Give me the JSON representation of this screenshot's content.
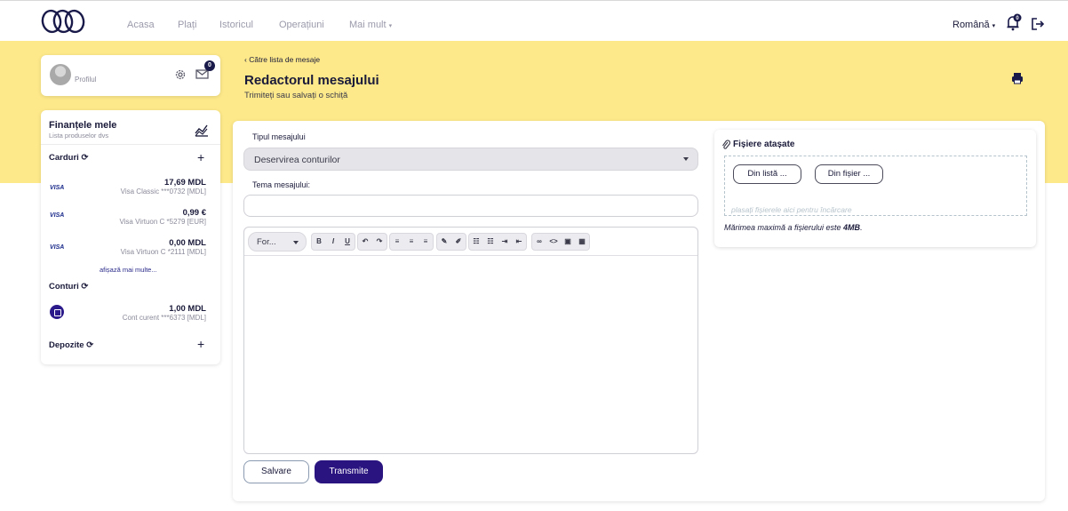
{
  "nav": {
    "items": [
      "Acasa",
      "Plați",
      "Istoricul",
      "Operațiuni",
      "Mai mult"
    ],
    "language": "Română",
    "notification_count": "0"
  },
  "sidebar": {
    "profile_label": "Profilul",
    "mail_count": "0",
    "finances_title": "Finanțele mele",
    "finances_subtitle": "Lista produselor dvs",
    "cards_title": "Carduri",
    "cards": [
      {
        "brand": "VISA",
        "amount": "17,69 MDL",
        "name": "Visa Classic ***0732 [MDL]"
      },
      {
        "brand": "VISA",
        "amount": "0,99 €",
        "name": "Visa Virtuon C *5279 [EUR]"
      },
      {
        "brand": "VISA",
        "amount": "0,00 MDL",
        "name": "Visa Virtuon C *2111 [MDL]"
      }
    ],
    "show_more": "afișază mai multe...",
    "accounts_title": "Conturi",
    "accounts": [
      {
        "amount": "1,00 MDL",
        "name": "Cont curent ***6373 [MDL]"
      }
    ],
    "deposits_title": "Depozite"
  },
  "header": {
    "back_link": "Către lista de mesaje",
    "title": "Redactorul mesajului",
    "subtitle": "Trimiteți sau salvați o schiță"
  },
  "form": {
    "type_label": "Tipul mesajului",
    "type_value": "Deservirea conturilor",
    "subject_label": "Tema mesajului:",
    "subject_value": "",
    "format_select": "For...",
    "toolbar_buttons": [
      "B",
      "I",
      "U",
      "↶",
      "↷",
      "≡",
      "≡",
      "≡",
      "✎",
      "✐",
      "☷",
      "☷",
      "⇥",
      "⇤",
      "∞",
      "<>",
      "▣",
      "▦"
    ],
    "save_label": "Salvare",
    "send_label": "Transmite"
  },
  "attachments": {
    "title": "Fișiere atașate",
    "from_list": "Din listă ...",
    "from_file": "Din fișier ...",
    "drop_hint": "plasați fișierele aici pentru încărcare",
    "max_size_prefix": "Mărimea maximă a fișierului este ",
    "max_size_value": "4MB",
    "max_size_suffix": "."
  },
  "colors": {
    "brand_yellow": "#fde98a",
    "brand_navy": "#2a1480",
    "text_dark": "#1a1a3a"
  }
}
